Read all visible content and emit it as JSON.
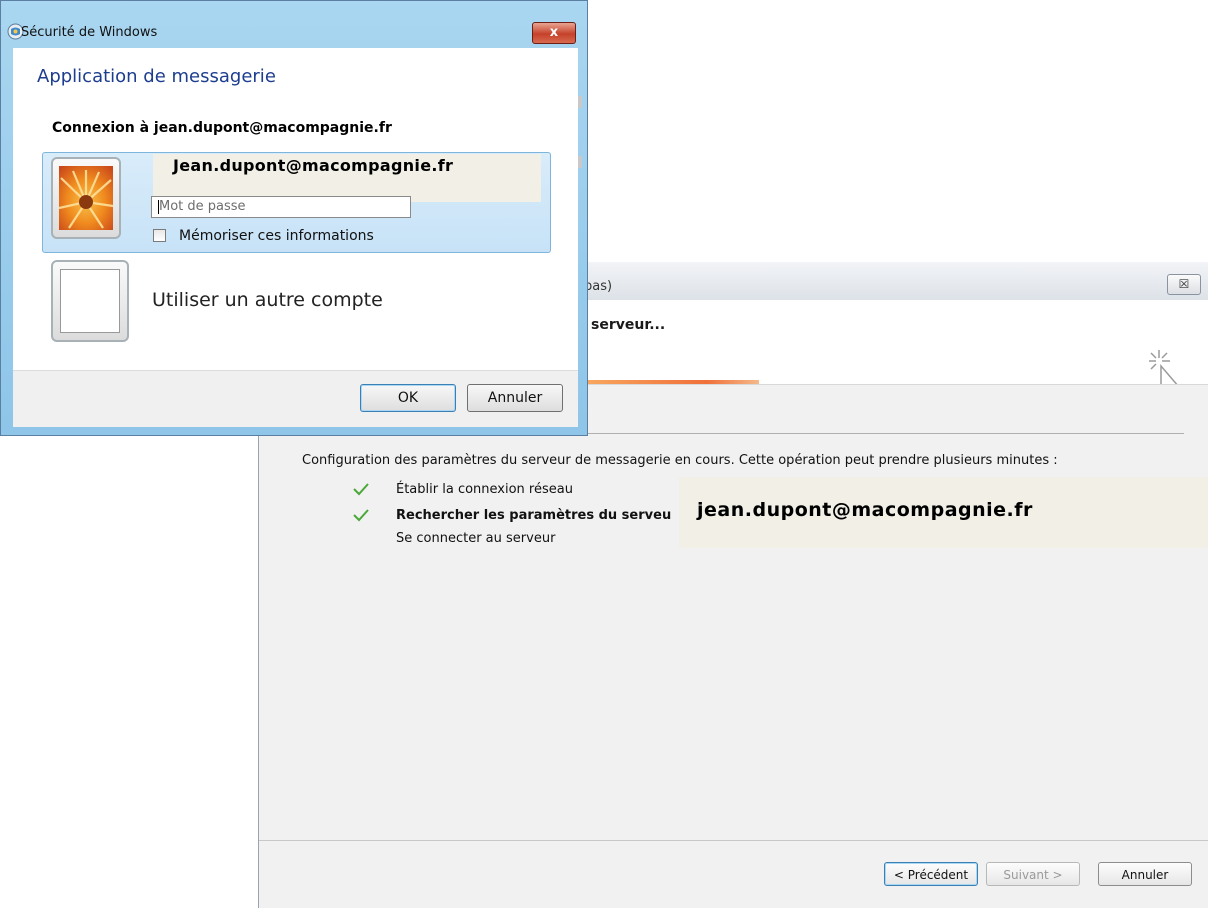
{
  "wizard": {
    "title_fragment": "bas)",
    "close_label": "☒",
    "header_text": "serveur...",
    "intro": "Configuration des paramètres du serveur de messagerie en cours. Cette opération peut prendre plusieurs minutes :",
    "steps": [
      {
        "label": "Établir la connexion réseau",
        "status": "done"
      },
      {
        "label": "Rechercher les paramètres du serveu",
        "status": "in-progress"
      },
      {
        "label": "Se connecter au serveur",
        "status": "pending"
      }
    ],
    "email_overlay": "jean.dupont@macompagnie.fr",
    "buttons": {
      "prev": "< Précédent",
      "next": "Suivant >",
      "cancel": "Annuler"
    }
  },
  "dialog": {
    "title": "Sécurité de Windows",
    "close_label": "x",
    "app_title": "Application de messagerie",
    "connect_label": "Connexion à jean.dupont@macompagnie.fr",
    "user_email": "Jean.dupont@macompagnie.fr",
    "password_placeholder": "Mot de passe",
    "remember_label": "Mémoriser ces informations",
    "remember_checked": false,
    "other_account_label": "Utiliser un autre compte",
    "buttons": {
      "ok": "OK",
      "cancel": "Annuler"
    }
  },
  "colors": {
    "accent_blue": "#1d3d8f",
    "progress_orange": "#f0703a",
    "check_green": "#4aa839",
    "close_red": "#c5412a"
  }
}
